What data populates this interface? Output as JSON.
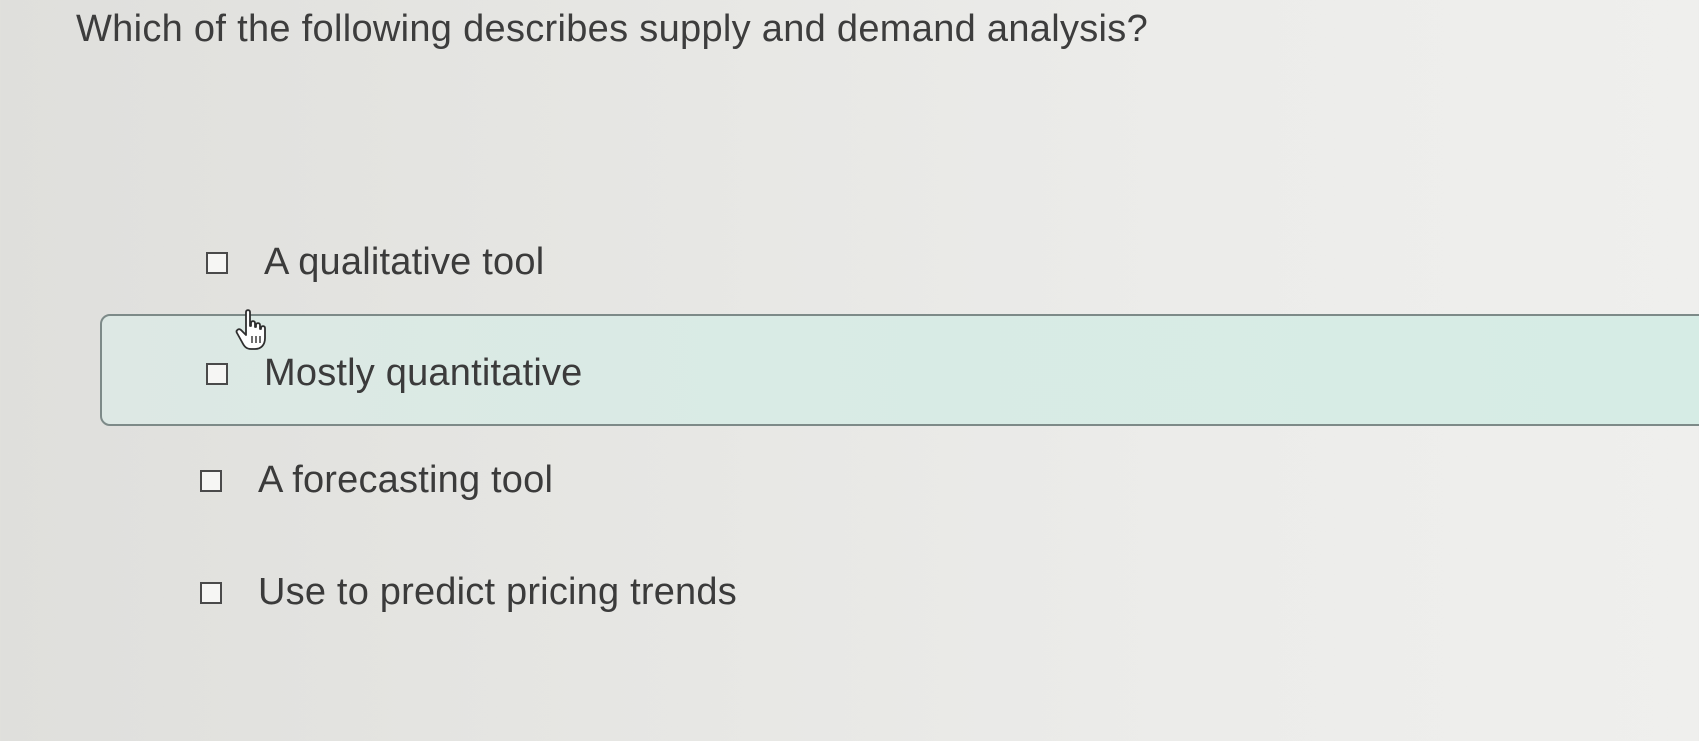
{
  "question": {
    "text": "Which of the following describes supply and demand analysis?"
  },
  "options": [
    {
      "label": "A qualitative tool",
      "checked": false,
      "hovered": false
    },
    {
      "label": "Mostly quantitative",
      "checked": false,
      "hovered": true
    },
    {
      "label": "A forecasting tool",
      "checked": false,
      "hovered": false
    },
    {
      "label": "Use to predict pricing trends",
      "checked": false,
      "hovered": false
    }
  ],
  "cursor": {
    "icon": "hand-pointer-icon"
  },
  "colors": {
    "highlight_fill": "#d9ebe5",
    "highlight_border": "#7d8a88",
    "text": "#3b3b3b"
  }
}
